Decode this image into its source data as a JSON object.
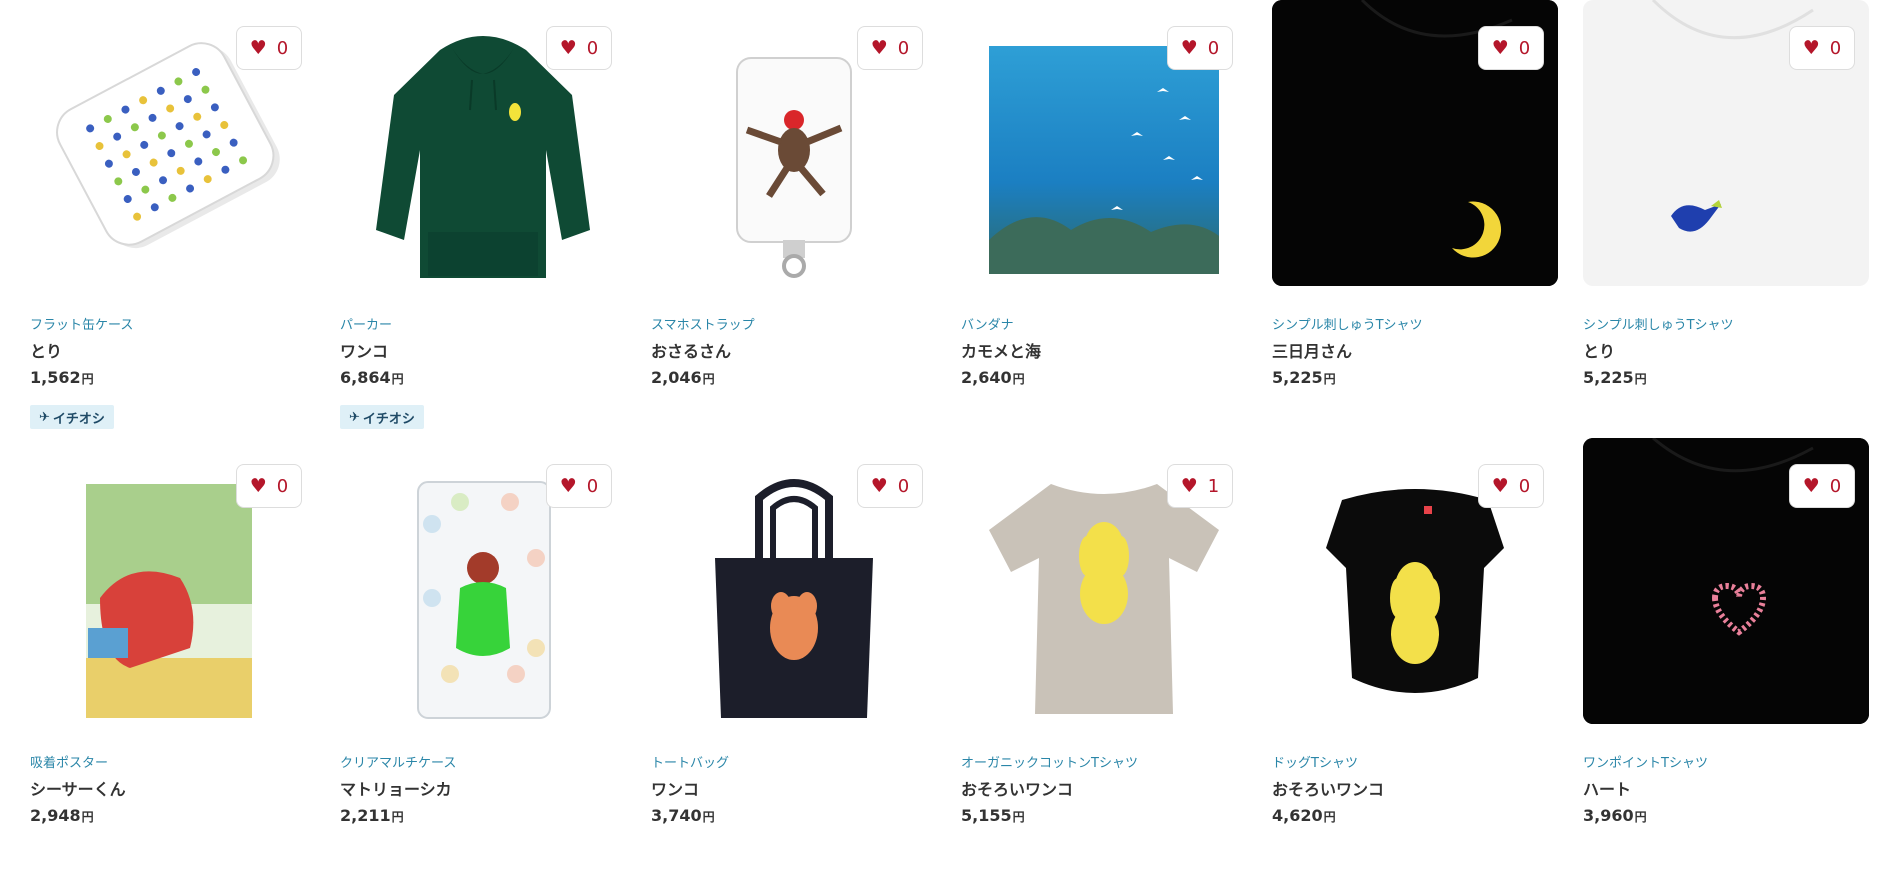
{
  "icons": {
    "favorite": "heart-icon",
    "badge": "pin-icon"
  },
  "colors": {
    "category": "#2a86a8",
    "heart": "#b4162a",
    "badge_bg": "#dff0f7"
  },
  "currency": "円",
  "products": [
    {
      "category": "フラット缶ケース",
      "name": "とり",
      "price": "1,562",
      "likes": "0",
      "badge": "イチオシ"
    },
    {
      "category": "パーカー",
      "name": "ワンコ",
      "price": "6,864",
      "likes": "0",
      "badge": "イチオシ"
    },
    {
      "category": "スマホストラップ",
      "name": "おさるさん",
      "price": "2,046",
      "likes": "0"
    },
    {
      "category": "バンダナ",
      "name": "カモメと海",
      "price": "2,640",
      "likes": "0"
    },
    {
      "category": "シンプル刺しゅうTシャツ",
      "name": "三日月さん",
      "price": "5,225",
      "likes": "0"
    },
    {
      "category": "シンプル刺しゅうTシャツ",
      "name": "とり",
      "price": "5,225",
      "likes": "0"
    },
    {
      "category": "吸着ポスター",
      "name": "シーサーくん",
      "price": "2,948",
      "likes": "0"
    },
    {
      "category": "クリアマルチケース",
      "name": "マトリョーシカ",
      "price": "2,211",
      "likes": "0"
    },
    {
      "category": "トートバッグ",
      "name": "ワンコ",
      "price": "3,740",
      "likes": "0"
    },
    {
      "category": "オーガニックコットンTシャツ",
      "name": "おそろいワンコ",
      "price": "5,155",
      "likes": "1"
    },
    {
      "category": "ドッグTシャツ",
      "name": "おそろいワンコ",
      "price": "4,620",
      "likes": "0"
    },
    {
      "category": "ワンポイントTシャツ",
      "name": "ハート",
      "price": "3,960",
      "likes": "0"
    }
  ]
}
